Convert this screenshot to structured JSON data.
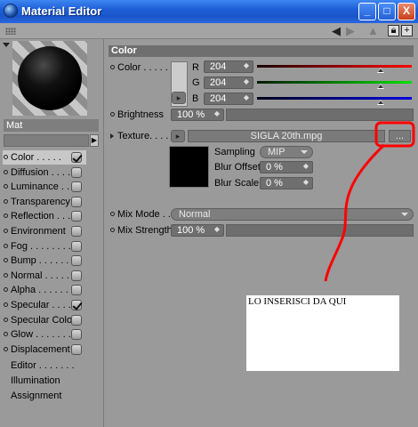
{
  "window": {
    "title": "Material Editor",
    "buttons": [
      "_",
      "□",
      "X"
    ]
  },
  "toolbar": {
    "icons": [
      "grip-icon",
      "back-arrow-icon",
      "forward-arrow-icon",
      "up-icon",
      "lock-icon",
      "new-window-icon"
    ]
  },
  "material": {
    "name": "Mat"
  },
  "channels": [
    {
      "label": "Color",
      "dots": ". . . . .",
      "checked": true,
      "selected": true
    },
    {
      "label": "Diffusion",
      "dots": ". . . .",
      "checked": false
    },
    {
      "label": "Luminance",
      "dots": ". . .",
      "checked": false
    },
    {
      "label": "Transparency",
      "dots": "",
      "checked": false
    },
    {
      "label": "Reflection",
      "dots": ". . .",
      "checked": false
    },
    {
      "label": "Environment",
      "dots": "",
      "checked": false
    },
    {
      "label": "Fog",
      "dots": ". . . . . . . .",
      "checked": false
    },
    {
      "label": "Bump",
      "dots": ". . . . . . .",
      "checked": false
    },
    {
      "label": "Normal",
      "dots": ". . . . . .",
      "checked": false
    },
    {
      "label": "Alpha",
      "dots": ". . . . . . .",
      "checked": false
    },
    {
      "label": "Specular",
      "dots": ". . . .",
      "checked": true
    },
    {
      "label": "Specular Color",
      "dots": "",
      "checked": false
    },
    {
      "label": "Glow",
      "dots": ". . . . . . . .",
      "checked": false
    },
    {
      "label": "Displacement",
      "dots": "",
      "checked": false
    }
  ],
  "extra_items": [
    "Editor . . . . . . .",
    "Illumination",
    "Assignment"
  ],
  "panel": {
    "header": "Color",
    "color_label": "Color . . . . . .",
    "rgb": {
      "R": "204",
      "G": "204",
      "B": "204",
      "fraction": 0.8
    },
    "brightness_label": "Brightness",
    "brightness_value": "100 %",
    "texture_label": "Texture. . . . . . .",
    "texture_file": "SIGLA 20th.mpg",
    "texture_more": "...",
    "sampling_label": "Sampling",
    "sampling_value": "MIP",
    "blur_offset_label": "Blur Offset",
    "blur_offset_value": "0 %",
    "blur_scale_label": "Blur Scale",
    "blur_scale_value": "0 %",
    "mix_mode_label": "Mix Mode . . . . .",
    "mix_mode_value": "Normal",
    "mix_strength_label": "Mix Strength",
    "mix_strength_value": "100 %"
  },
  "annotation": {
    "text": "LO INSERISCI DA QUI",
    "color": "#ff0000"
  }
}
